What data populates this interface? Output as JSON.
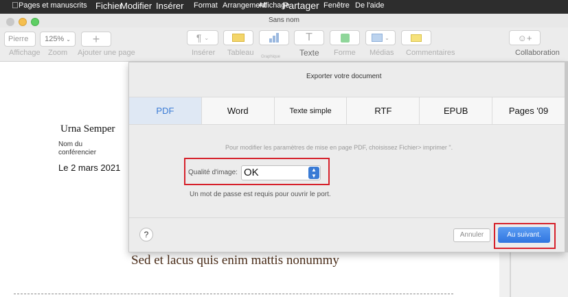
{
  "menubar": {
    "items": [
      "Pages et manuscrits",
      "Fichier",
      "Modifier",
      "Insérer",
      "Format",
      "Arrangement",
      "Affichage",
      "Partager",
      "Fenêtre",
      "De l'aide"
    ]
  },
  "window": {
    "title": "Sans nom"
  },
  "toolbar": {
    "view_value": "Pierre",
    "zoom_value": "125%",
    "add_page_icon": "+",
    "labels": {
      "affichage": "Affichage",
      "zoom": "Zoom",
      "add_page": "Ajouter une page",
      "inserer": "Insérer",
      "tableau": "Tableau",
      "graphique": "Graphique",
      "texte": "Texte",
      "forme": "Forme",
      "medias": "Médias",
      "commentaires": "Commentaires",
      "collaboration": "Collaboration"
    }
  },
  "document": {
    "name": "Urna Semper",
    "role": "Nom du conférencier",
    "date": "Le 2 mars 2021",
    "body": "Sed et lacus quis enim mattis nonummy"
  },
  "export": {
    "title": "Exporter votre document",
    "tabs": [
      {
        "label": "PDF",
        "selected": true
      },
      {
        "label": "Word",
        "selected": false
      },
      {
        "label": "Texte simple",
        "selected": false
      },
      {
        "label": "RTF",
        "selected": false
      },
      {
        "label": "EPUB",
        "selected": false
      },
      {
        "label": "Pages '09",
        "selected": false
      }
    ],
    "hint": "Pour modifier les paramètres de mise en page PDF, choisissez Fichier> imprimer \".",
    "quality_label": "Qualité d'image:",
    "quality_value": "OK",
    "password_note": "Un mot de passe est requis pour ouvrir le port.",
    "help": "?",
    "cancel": "Annuler",
    "next": "Au suivant."
  },
  "colors": {
    "accent": "#3a7bd5",
    "highlight": "#d6202a",
    "body_text": "#4a2c18"
  }
}
